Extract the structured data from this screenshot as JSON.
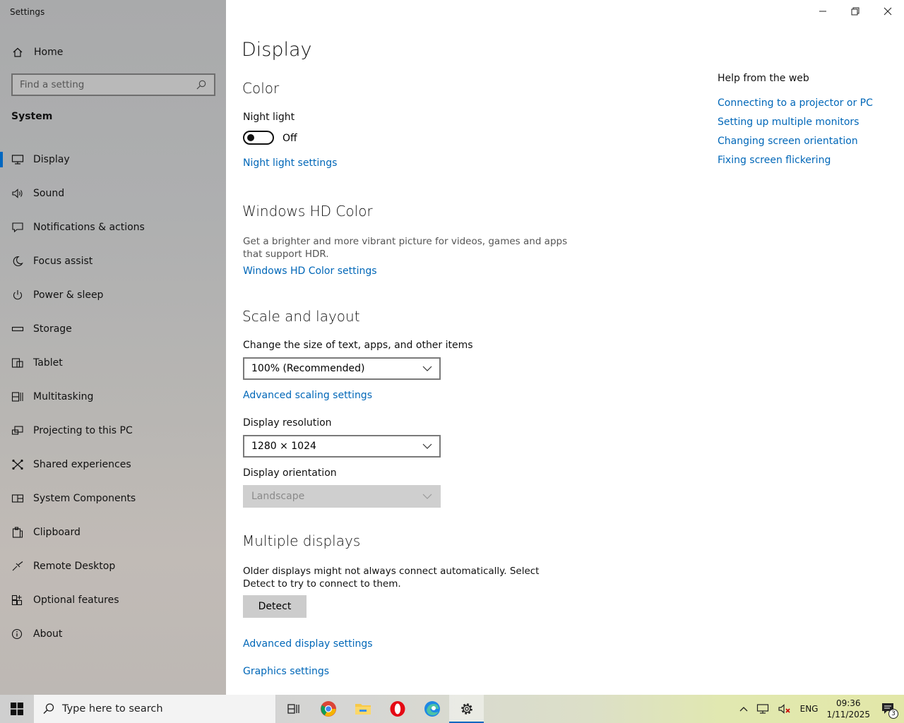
{
  "window": {
    "title": "Settings"
  },
  "sidebar": {
    "home_label": "Home",
    "search_placeholder": "Find a setting",
    "section_label": "System",
    "items": [
      {
        "label": "Display",
        "icon": "monitor-icon",
        "active": true
      },
      {
        "label": "Sound",
        "icon": "speaker-icon"
      },
      {
        "label": "Notifications & actions",
        "icon": "notification-icon"
      },
      {
        "label": "Focus assist",
        "icon": "moon-icon"
      },
      {
        "label": "Power & sleep",
        "icon": "power-icon"
      },
      {
        "label": "Storage",
        "icon": "storage-icon"
      },
      {
        "label": "Tablet",
        "icon": "tablet-icon"
      },
      {
        "label": "Multitasking",
        "icon": "multitasking-icon"
      },
      {
        "label": "Projecting to this PC",
        "icon": "projector-icon"
      },
      {
        "label": "Shared experiences",
        "icon": "shared-icon"
      },
      {
        "label": "System Components",
        "icon": "components-icon"
      },
      {
        "label": "Clipboard",
        "icon": "clipboard-icon"
      },
      {
        "label": "Remote Desktop",
        "icon": "remote-icon"
      },
      {
        "label": "Optional features",
        "icon": "features-icon"
      },
      {
        "label": "About",
        "icon": "info-icon"
      }
    ]
  },
  "main": {
    "title": "Display",
    "color": {
      "heading": "Color",
      "night_light_label": "Night light",
      "toggle_state": "Off",
      "night_light_link": "Night light settings"
    },
    "hdr": {
      "heading": "Windows HD Color",
      "description": "Get a brighter and more vibrant picture for videos, games and apps that support HDR.",
      "link": "Windows HD Color settings"
    },
    "scale": {
      "heading": "Scale and layout",
      "size_label": "Change the size of text, apps, and other items",
      "size_value": "100% (Recommended)",
      "advanced_link": "Advanced scaling settings",
      "resolution_label": "Display resolution",
      "resolution_value": "1280 × 1024",
      "orientation_label": "Display orientation",
      "orientation_value": "Landscape"
    },
    "multiple": {
      "heading": "Multiple displays",
      "description": "Older displays might not always connect automatically. Select Detect to try to connect to them.",
      "detect_label": "Detect",
      "advanced_display_link": "Advanced display settings",
      "graphics_link": "Graphics settings"
    }
  },
  "help": {
    "title": "Help from the web",
    "links": [
      "Connecting to a projector or PC",
      "Setting up multiple monitors",
      "Changing screen orientation",
      "Fixing screen flickering"
    ]
  },
  "taskbar": {
    "search_placeholder": "Type here to search",
    "language": "ENG",
    "time": "09:36",
    "date": "1/11/2025",
    "notification_count": "3"
  }
}
